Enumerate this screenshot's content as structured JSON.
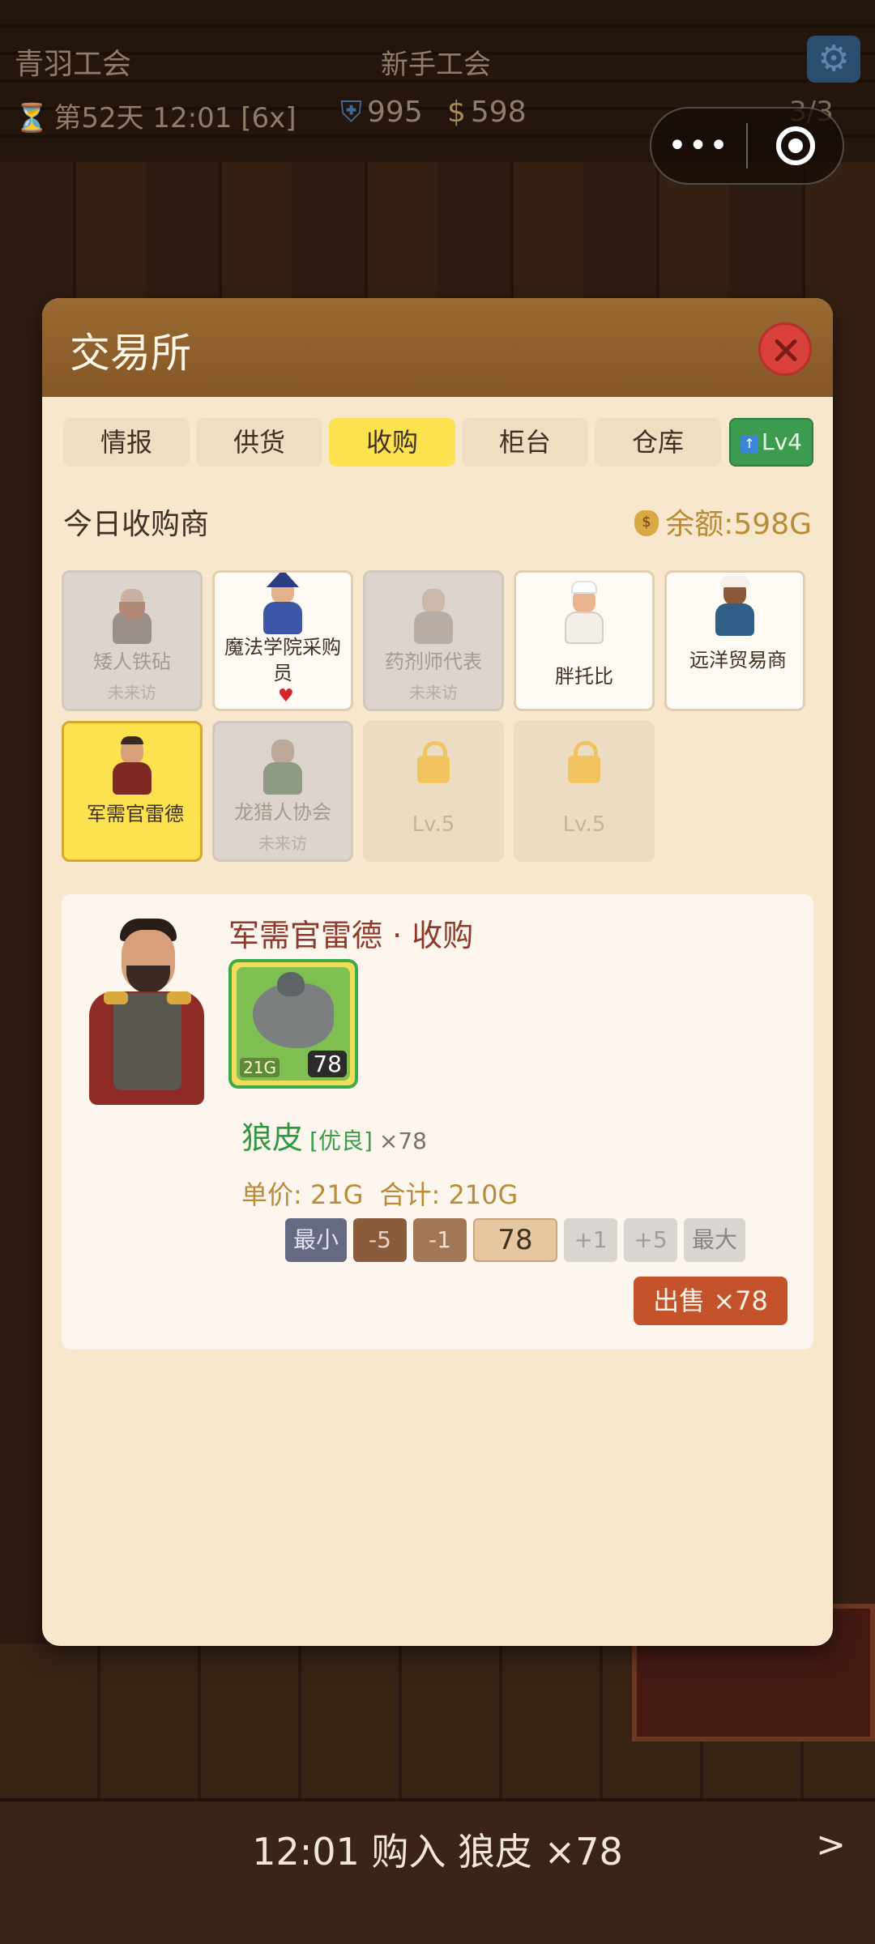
{
  "hud": {
    "guild_name": "青羽工会",
    "guild_rank": "新手工会",
    "day": "第52天 12:01 [6x]",
    "reputation": "995",
    "gold": "598",
    "party": "3/3"
  },
  "capsule": {
    "more": "•••"
  },
  "modal": {
    "title": "交易所",
    "tabs": [
      "情报",
      "供货",
      "收购",
      "柜台",
      "仓库"
    ],
    "active_tab_index": 2,
    "level_badge": "Lv4",
    "section_title": "今日收购商",
    "balance": "余额:598G"
  },
  "merchants": [
    {
      "name": "矮人铁砧",
      "status": "未来访",
      "state": "dim"
    },
    {
      "name": "魔法学院采购员",
      "status": "",
      "state": "normal",
      "favorite": true
    },
    {
      "name": "药剂师代表",
      "status": "未来访",
      "state": "dim"
    },
    {
      "name": "胖托比",
      "status": "",
      "state": "normal"
    },
    {
      "name": "远洋贸易商",
      "status": "",
      "state": "normal"
    },
    {
      "name": "军需官雷德",
      "status": "",
      "state": "selected"
    },
    {
      "name": "龙猎人协会",
      "status": "未来访",
      "state": "dim"
    },
    {
      "name": "",
      "status": "Lv.5",
      "state": "locked"
    },
    {
      "name": "",
      "status": "Lv.5",
      "state": "locked"
    }
  ],
  "detail": {
    "title": "军需官雷德 · 收购",
    "item": {
      "price_tag": "21G",
      "quantity_badge": "78",
      "name": "狼皮",
      "quality": "[优良]",
      "multiplier": "×78"
    },
    "unit_price": "单价: 21G",
    "total": "合计: 210G",
    "stepper": {
      "min": "最小",
      "minus5": "-5",
      "minus1": "-1",
      "value": "78",
      "plus1": "+1",
      "plus5": "+5",
      "max": "最大"
    },
    "sell_button": "出售 ×78"
  },
  "log": {
    "text": "12:01 购入 狼皮 ×78",
    "next": ">"
  },
  "colors": {
    "accent_yellow": "#fde24f",
    "header_brown": "#8f5f2c",
    "green": "#3c9b4f",
    "sell_orange": "#c4522a",
    "gold_text": "#b98b36"
  }
}
